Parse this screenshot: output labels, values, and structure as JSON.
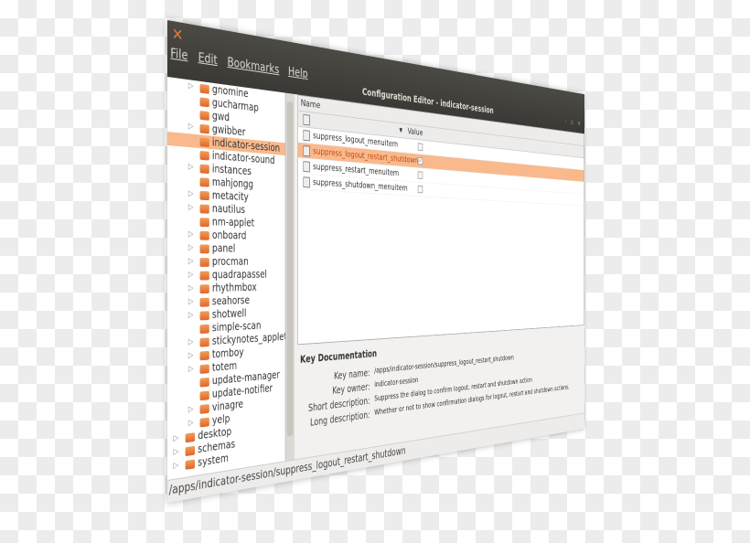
{
  "window": {
    "title": "Configuration Editor - indicator-session",
    "icon": "gconf-tools-icon"
  },
  "menu": [
    "File",
    "Edit",
    "Bookmarks",
    "Help"
  ],
  "tree": [
    {
      "label": "gnomine",
      "expander": true,
      "level": 1
    },
    {
      "label": "gucharmap",
      "expander": false,
      "level": 1
    },
    {
      "label": "gwd",
      "expander": false,
      "level": 1
    },
    {
      "label": "gwibber",
      "expander": true,
      "level": 1
    },
    {
      "label": "indicator-session",
      "expander": false,
      "level": 1,
      "selected": true
    },
    {
      "label": "indicator-sound",
      "expander": false,
      "level": 1
    },
    {
      "label": "instances",
      "expander": true,
      "level": 1
    },
    {
      "label": "mahjongg",
      "expander": false,
      "level": 1
    },
    {
      "label": "metacity",
      "expander": true,
      "level": 1
    },
    {
      "label": "nautilus",
      "expander": true,
      "level": 1
    },
    {
      "label": "nm-applet",
      "expander": false,
      "level": 1
    },
    {
      "label": "onboard",
      "expander": true,
      "level": 1
    },
    {
      "label": "panel",
      "expander": true,
      "level": 1
    },
    {
      "label": "procman",
      "expander": true,
      "level": 1
    },
    {
      "label": "quadrapassel",
      "expander": true,
      "level": 1
    },
    {
      "label": "rhythmbox",
      "expander": true,
      "level": 1
    },
    {
      "label": "seahorse",
      "expander": true,
      "level": 1
    },
    {
      "label": "shotwell",
      "expander": true,
      "level": 1
    },
    {
      "label": "simple-scan",
      "expander": false,
      "level": 1
    },
    {
      "label": "stickynotes_applet",
      "expander": true,
      "level": 1
    },
    {
      "label": "tomboy",
      "expander": true,
      "level": 1
    },
    {
      "label": "totem",
      "expander": true,
      "level": 1
    },
    {
      "label": "update-manager",
      "expander": false,
      "level": 1
    },
    {
      "label": "update-notifier",
      "expander": false,
      "level": 1
    },
    {
      "label": "vinagre",
      "expander": true,
      "level": 1
    },
    {
      "label": "yelp",
      "expander": true,
      "level": 1
    },
    {
      "label": "desktop",
      "expander": true,
      "level": 0
    },
    {
      "label": "schemas",
      "expander": true,
      "level": 0
    },
    {
      "label": "system",
      "expander": true,
      "level": 0
    }
  ],
  "list": {
    "col_name": "Name",
    "col_value": "Value",
    "rows": [
      {
        "name": "suppress_logout_menuitem",
        "checked": false
      },
      {
        "name": "suppress_logout_restart_shutdown",
        "checked": true,
        "selected": true
      },
      {
        "name": "suppress_restart_menuitem",
        "checked": false
      },
      {
        "name": "suppress_shutdown_menuitem",
        "checked": false
      }
    ]
  },
  "doc": {
    "heading": "Key Documentation",
    "fields": [
      {
        "label": "Key name:",
        "value": "/apps/indicator-session/suppress_logout_restart_shutdown"
      },
      {
        "label": "Key owner:",
        "value": "indicator-session"
      },
      {
        "label": "Short description:",
        "value": "Suppress the dialog to confirm logout, restart and shutdown action"
      },
      {
        "label": "Long description:",
        "value": "Whether or not to show confirmation dialogs for logout, restart and shutdown actions."
      }
    ]
  },
  "status": "/apps/indicator-session/suppress_logout_restart_shutdown",
  "colors": {
    "selection": "#f9b98d",
    "titlebar": "#3c3b37",
    "folder": "#e8702e"
  }
}
